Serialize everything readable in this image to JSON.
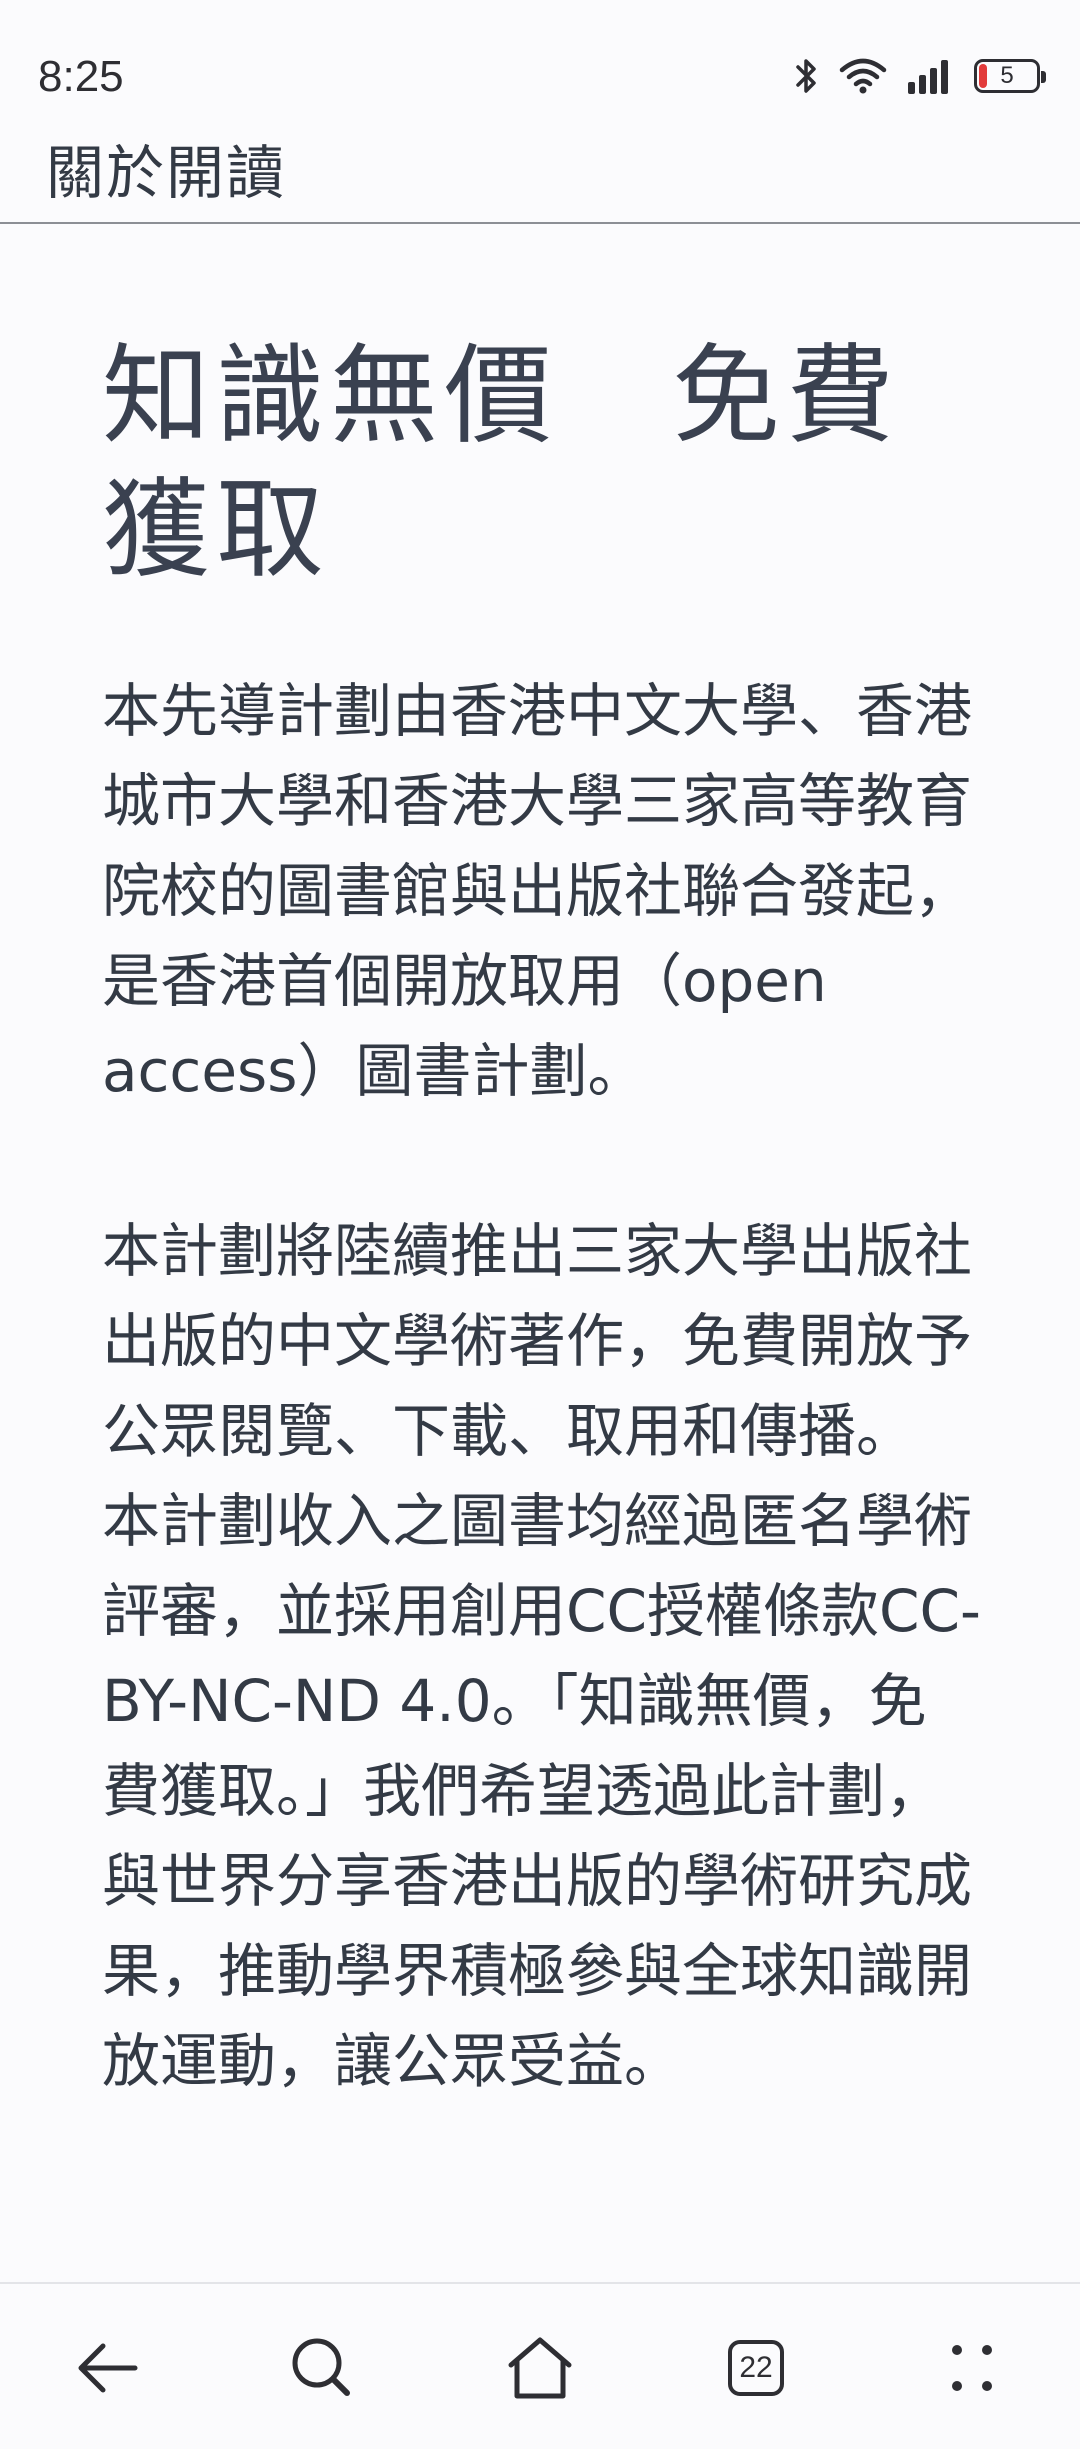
{
  "status_bar": {
    "time": "8:25",
    "icons": [
      "bluetooth-icon",
      "wifi-icon",
      "signal-icon",
      "battery-icon"
    ],
    "battery_level": "5",
    "battery_low_color": "#e23b3b"
  },
  "header": {
    "title": "關於開讀"
  },
  "main": {
    "heading": "知識無價　免費獲取",
    "paragraphs": [
      "本先導計劃由香港中文大學、香港城市大學和香港大學三家高等教育院校的圖書館與出版社聯合發起，是香港首個開放取用（open access）圖書計劃。",
      "本計劃將陸續推出三家大學出版社出版的中文學術著作，免費開放予公眾閱覽、下載、取用和傳播。 本計劃收入之圖書均經過匿名學術評審，並採用創用CC授權條款CC-BY-NC-ND 4.0。「知識無價，免費獲取。」我們希望透過此計劃，與世界分享香港出版的學術研究成果，推動學界積極參與全球知識開放運動，讓公眾受益。"
    ]
  },
  "bottom_nav": {
    "icons": [
      "back-arrow-icon",
      "search-icon",
      "home-icon",
      "tabs-icon",
      "menu-dots-icon"
    ],
    "tab_count": "22"
  }
}
